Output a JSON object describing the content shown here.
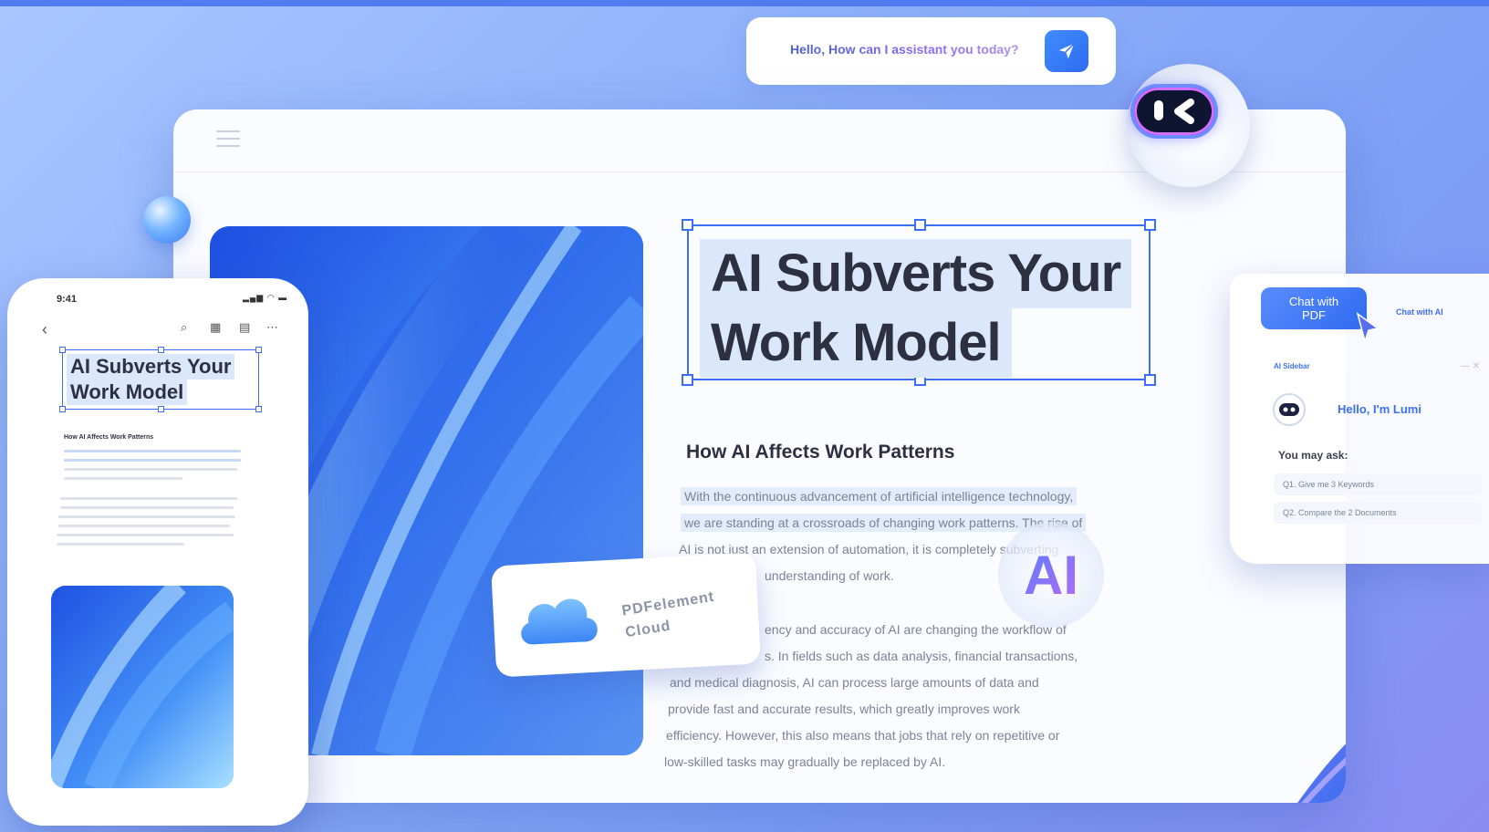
{
  "chat": {
    "prompt": "Hello, How can I assistant you today?",
    "send_icon": "paper-plane-icon"
  },
  "document": {
    "title_line1": "AI Subverts Your",
    "title_line2": "Work Model",
    "section_heading": "How AI Affects Work Patterns",
    "paragraph1": [
      "With the continuous advancement of artificial intelligence technology,",
      "we are standing at a crossroads of changing work patterns. The rise of",
      "AI is not just an extension of automation, it is completely subverting",
      "understanding of work."
    ],
    "paragraph2": [
      "ency and accuracy of AI are changing the workflow of",
      "s. In fields such as data analysis, financial transactions,",
      "and medical diagnosis, AI can process large amounts of data and",
      "provide fast and accurate results, which greatly improves work",
      "efficiency. However, this also means that jobs that rely on repetitive or",
      "low-skilled tasks may gradually be replaced by AI."
    ]
  },
  "cloud_card": {
    "line1": "PDFelement",
    "line2": "Cloud"
  },
  "ai_badge": "AI",
  "side_panel": {
    "tab_pdf_line1": "Chat with",
    "tab_pdf_line2": "PDF",
    "tab_ai": "Chat with AI",
    "sidebar_label": "AI Sidebar",
    "controls": "— ✕",
    "greeting": "Hello, I'm Lumi",
    "ask_label": "You may ask:",
    "questions": [
      "Q1. Give me 3 Keywords",
      "Q2. Compare the 2 Documents"
    ]
  },
  "phone": {
    "time": "9:41",
    "status": "▂▄▆ ◠ ▬",
    "title_line1": "AI Subverts Your",
    "title_line2": "Work Model",
    "heading": "How AI Affects Work Patterns"
  },
  "colors": {
    "accent": "#3b6ff5",
    "background": "#8fb2fb"
  }
}
